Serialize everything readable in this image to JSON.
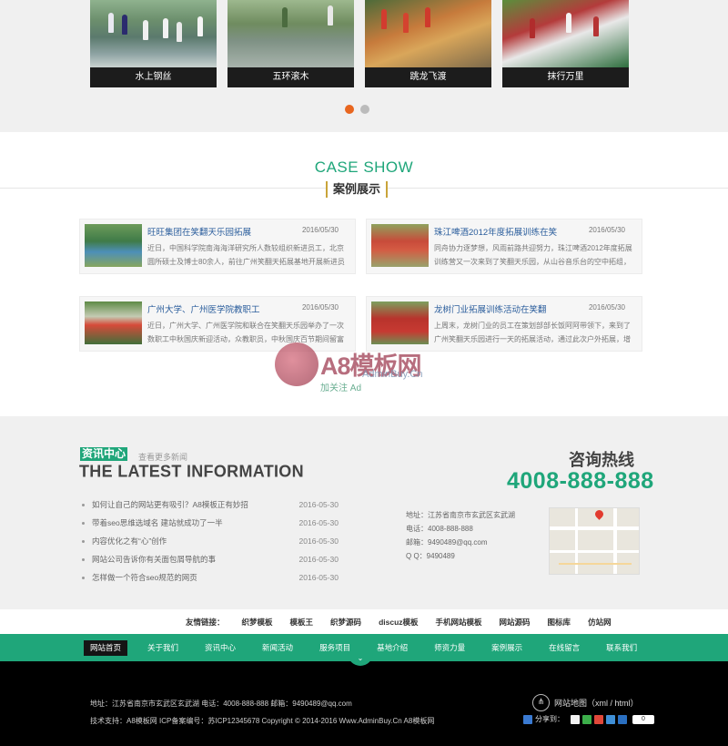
{
  "activities": {
    "items": [
      {
        "caption": "水上钢丝"
      },
      {
        "caption": "五环滚木"
      },
      {
        "caption": "跳龙飞渡"
      },
      {
        "caption": "抹行万里"
      }
    ]
  },
  "cases": {
    "title_en": "CASE SHOW",
    "title_cn": "案例展示",
    "items": [
      {
        "title": "旺旺集团在笑翻天乐园拓展",
        "date": "2016/05/30",
        "desc": "近日，中国科学院南海海洋研究所人数较组织新进员工，北京圆所硕士及博士80余人，前往广州笑翻天拓展基地开展新进员"
      },
      {
        "title": "珠江啤酒2012年度拓展训练在笑",
        "date": "2016/05/30",
        "desc": "同舟协力逐梦想，风雨前路共迎努力，珠江啤酒2012年度拓展训练营又一次来到了笑翻天乐园，从山谷音乐台的空中拓组，组建团"
      },
      {
        "title": "广州大学、广州医学院教职工",
        "date": "2016/05/30",
        "desc": "近日，广州大学、广州医学院和联合在笑翻天乐园举办了一次数职工中秋国庆新迎活动，众教职员，中秋国庆百节期间留富温馨上"
      },
      {
        "title": "龙树门业拓展训练活动在笑翻",
        "date": "2016/05/30",
        "desc": "上周末，龙树门业的员工在策划部部长饭阿阿带领下，来到了广州笑翻天乐园进行一天的拓展活动，通过此次户外拓展，增强她展"
      }
    ]
  },
  "watermark": {
    "brand": "A8模板网",
    "url": "AdminBuy.Cn",
    "sub": "加关注 Ad"
  },
  "news": {
    "tag": "资讯中心",
    "more": "查看更多新闻",
    "title_en": "THE LATEST INFORMATION",
    "items": [
      {
        "title": "如何让自己的网站更有吸引？A8模板正有妙招",
        "date": "2016-05-30"
      },
      {
        "title": "带着seo思维选域名 建站就成功了一半",
        "date": "2016-05-30"
      },
      {
        "title": "内容优化之有“心”创作",
        "date": "2016-05-30"
      },
      {
        "title": "网站公司告诉你有关面包屑导航的事",
        "date": "2016-05-30"
      },
      {
        "title": "怎样做一个符合seo规范的网页",
        "date": "2016-05-30"
      }
    ]
  },
  "hotline": {
    "label": "咨询热线",
    "number": "4008-888-888",
    "contacts": [
      "地址：江苏省南京市玄武区玄武湖",
      "电话：4008-888-888",
      "邮箱：9490489@qq.com",
      "Q Q：9490489"
    ]
  },
  "friend_links": {
    "items": [
      "友情链接：",
      "织梦模板",
      "模板王",
      "织梦源码",
      "discuz模板",
      "手机网站模板",
      "网站源码",
      "图标库",
      "仿站网"
    ]
  },
  "nav": {
    "items": [
      "网站首页",
      "关于我们",
      "资讯中心",
      "新闻活动",
      "服务项目",
      "基地介绍",
      "师资力量",
      "案例展示",
      "在线留言",
      "联系我们"
    ],
    "toggle": "⌄"
  },
  "footer": {
    "line1": "地址：江苏省南京市玄武区玄武湖  电话：4008-888-888  邮箱：9490489@qq.com",
    "line2": "技术支持：A8模板网  ICP备案编号：苏ICP12345678 Copyright © 2014-2016 Www.AdminBuy.Cn A8模板网",
    "sitemap": "网站地图（xml / html）",
    "share_label": "分享到：",
    "share_count": "0"
  },
  "colors": {
    "accent": "#1fa67a",
    "active_dot": "#e8661f",
    "footer_bg": "#000000"
  }
}
